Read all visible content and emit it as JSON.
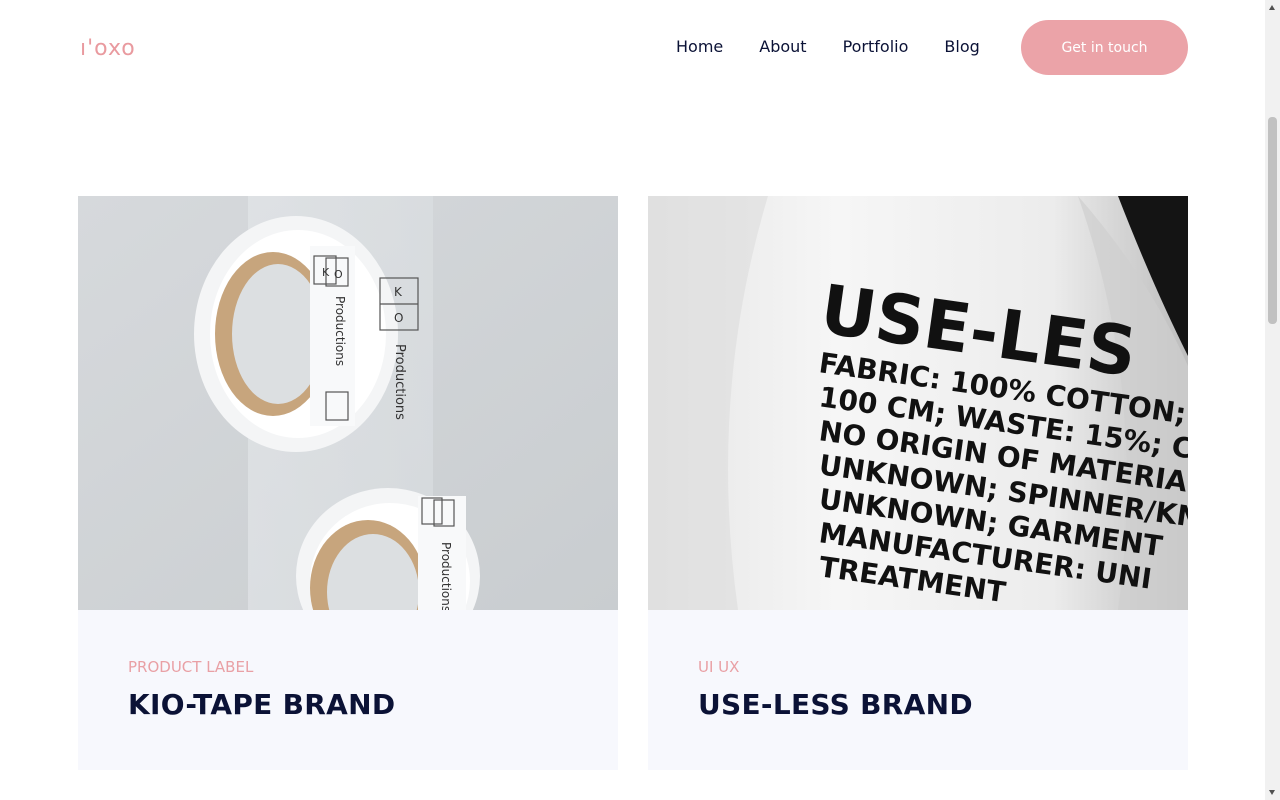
{
  "brand": {
    "logo_text": "ı'oxo",
    "accent": "#eba3a8",
    "navy": "#0b1236"
  },
  "nav": {
    "items": [
      {
        "label": "Home"
      },
      {
        "label": "About"
      },
      {
        "label": "Portfolio"
      },
      {
        "label": "Blog"
      }
    ],
    "cta_label": "Get in touch"
  },
  "cards": [
    {
      "category": "PRODUCT LABEL",
      "title": "KIO-TAPE BRAND",
      "image": {
        "description_icon": "tape-roll-photo",
        "tape_text_a": "K",
        "tape_text_b": "O",
        "tape_word": "Productions"
      }
    },
    {
      "category": "UI UX",
      "title": "USE-LESS BRAND",
      "image": {
        "description_icon": "garment-label-photo",
        "heading": "USE-LES",
        "lines": [
          "FABRIC: 100% COTTON;",
          "100 CM; WASTE: 15%; C",
          "NO ORIGIN OF MATERIA",
          "UNKNOWN; SPINNER/KN",
          "UNKNOWN; GARMENT",
          "MANUFACTURER: UNI",
          "TREATMENT"
        ]
      }
    }
  ]
}
